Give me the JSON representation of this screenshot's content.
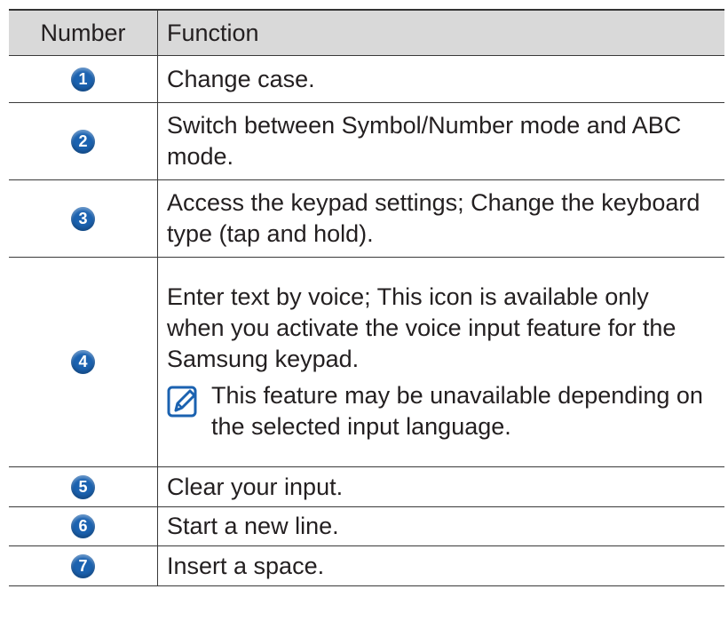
{
  "table": {
    "headers": {
      "number": "Number",
      "function": "Function"
    },
    "rows": [
      {
        "number": "1",
        "function": "Change case."
      },
      {
        "number": "2",
        "function": "Switch between Symbol/Number mode and ABC mode."
      },
      {
        "number": "3",
        "function": "Access the keypad settings; Change the keyboard type (tap and hold)."
      },
      {
        "number": "4",
        "function": "Enter text by voice; This icon is available only when you activate the voice input feature for the Samsung keypad.",
        "note": "This feature may be unavailable depending on the selected input language."
      },
      {
        "number": "5",
        "function": "Clear your input."
      },
      {
        "number": "6",
        "function": "Start a new line."
      },
      {
        "number": "7",
        "function": "Insert a space."
      }
    ]
  },
  "colors": {
    "badge": "#1b62b0",
    "header_bg": "#d9d9d9"
  },
  "icons": {
    "note": "note-pencil-icon"
  }
}
